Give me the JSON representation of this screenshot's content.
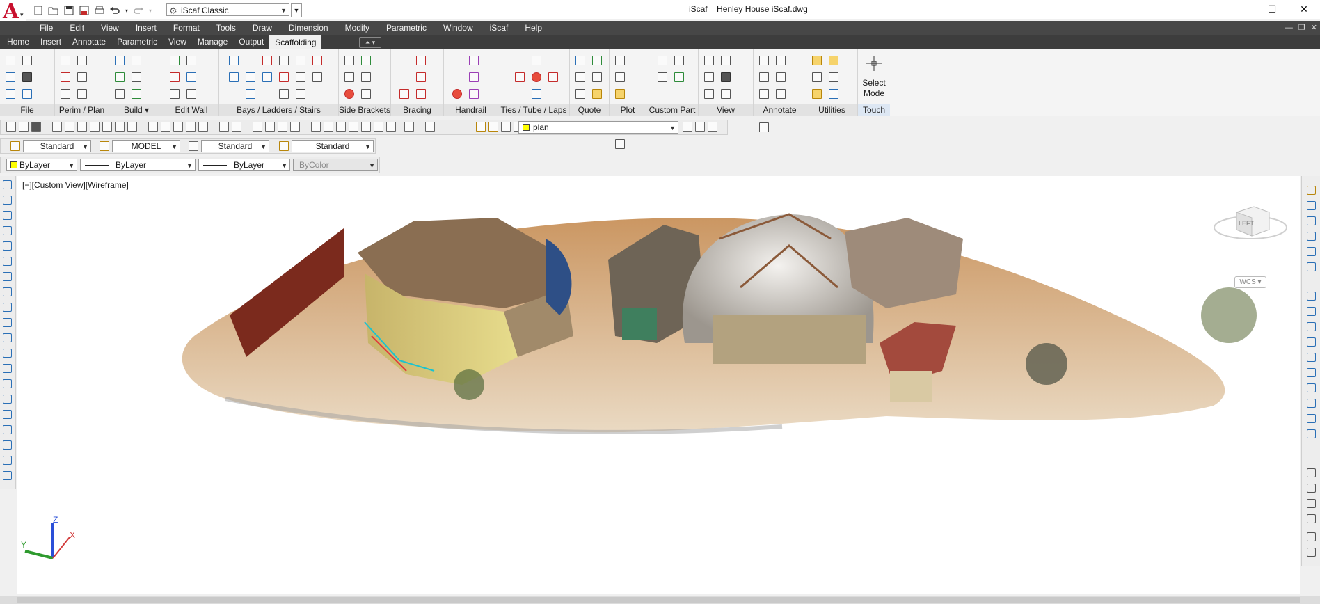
{
  "window": {
    "app_title": "iScaf",
    "document_title": "Henley House iScaf.dwg",
    "app_logo_letter": "A"
  },
  "workspace": {
    "selected": "iScaf Classic"
  },
  "menu": [
    "File",
    "Edit",
    "View",
    "Insert",
    "Format",
    "Tools",
    "Draw",
    "Dimension",
    "Modify",
    "Parametric",
    "Window",
    "iScaf",
    "Help"
  ],
  "ribbon_tabs": [
    "Home",
    "Insert",
    "Annotate",
    "Parametric",
    "View",
    "Manage",
    "Output",
    "Scaffolding"
  ],
  "active_tab": "Scaffolding",
  "ribbon_panels": [
    {
      "label": "File"
    },
    {
      "label": "Perim / Plan"
    },
    {
      "label": "Build  ▾"
    },
    {
      "label": "Edit Wall"
    },
    {
      "label": "Bays / Ladders / Stairs"
    },
    {
      "label": "Side Brackets"
    },
    {
      "label": "Bracing"
    },
    {
      "label": "Handrail"
    },
    {
      "label": "Ties / Tube / Laps"
    },
    {
      "label": "Quote"
    },
    {
      "label": "Plot"
    },
    {
      "label": "Custom Part"
    },
    {
      "label": "View"
    },
    {
      "label": "Annotate"
    },
    {
      "label": "Utilities"
    },
    {
      "label": "Touch"
    }
  ],
  "select_mode": {
    "line1": "Select",
    "line2": "Mode"
  },
  "layer": {
    "current": "plan"
  },
  "styles": {
    "text_style": "Standard",
    "dim_style": "MODEL",
    "table_style": "Standard",
    "mleader_style": "Standard"
  },
  "properties": {
    "color": "ByLayer",
    "linetype": "ByLayer",
    "lineweight": "ByLayer",
    "plotstyle": "ByColor"
  },
  "viewport": {
    "label": "[−][Custom View][Wireframe]"
  },
  "viewcube": {
    "face": "LEFT",
    "wcs": "WCS"
  },
  "ucs": {
    "x": "X",
    "y": "Y",
    "z": "Z"
  },
  "colors": {
    "menubar": "#474747",
    "tabbar": "#3d3d3d",
    "accent": "#2a6fb6",
    "logo": "#c8102e"
  }
}
